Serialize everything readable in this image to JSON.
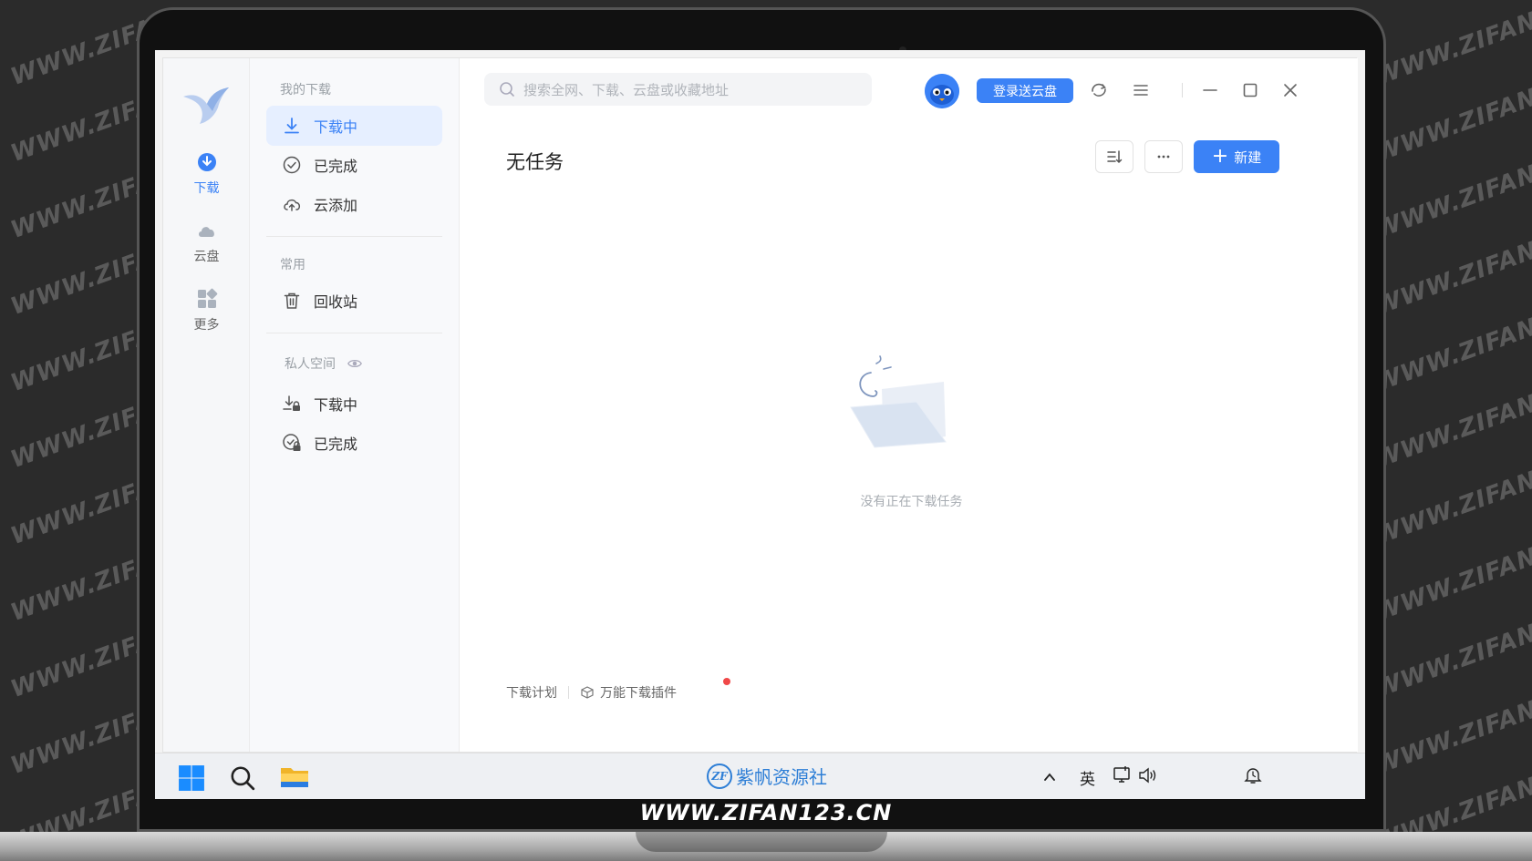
{
  "watermark": "WWW.ZIFAN123.CN",
  "bottom_url": "WWW.ZIFAN123.CN",
  "nav": {
    "items": [
      {
        "label": "下载",
        "icon": "download-circle-icon",
        "active": true
      },
      {
        "label": "云盘",
        "icon": "cloud-icon",
        "active": false
      },
      {
        "label": "更多",
        "icon": "apps-grid-icon",
        "active": false
      }
    ]
  },
  "sidebar": {
    "section_my": "我的下载",
    "my_items": [
      {
        "label": "下载中",
        "icon": "download-arrow-icon",
        "active": true
      },
      {
        "label": "已完成",
        "icon": "check-circle-icon",
        "active": false
      },
      {
        "label": "云添加",
        "icon": "cloud-upload-icon",
        "active": false
      }
    ],
    "section_common": "常用",
    "common_items": [
      {
        "label": "回收站",
        "icon": "trash-icon"
      }
    ],
    "section_private": "私人空间",
    "private_items": [
      {
        "label": "下载中",
        "icon": "lock-download-icon"
      },
      {
        "label": "已完成",
        "icon": "lock-check-icon"
      }
    ]
  },
  "header": {
    "search_placeholder": "搜索全网、下载、云盘或收藏地址",
    "login_button": "登录送云盘"
  },
  "main": {
    "title": "无任务",
    "new_button": "新建",
    "empty_text": "没有正在下载任务",
    "footer": {
      "plan": "下载计划",
      "plugin": "万能下载插件"
    }
  },
  "taskbar": {
    "brand": "紫帆资源社",
    "brand_logo": "ZF",
    "ime": "英"
  },
  "colors": {
    "accent": "#3b82f6",
    "active_bg": "#e6efff"
  }
}
